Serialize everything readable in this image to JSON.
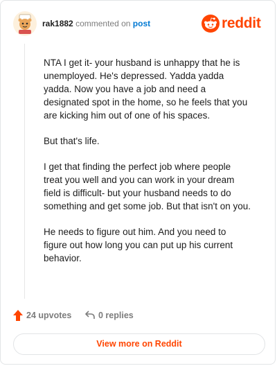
{
  "header": {
    "username": "rak1882",
    "action_text": "commented on",
    "target_link": "post",
    "brand_name": "reddit"
  },
  "comment": {
    "paragraphs": [
      "NTA I get it- your husband is unhappy that he is unemployed. He's depressed. Yadda yadda yadda. Now you have a job and need a designated spot in the home, so he feels that you are kicking him out of one of his spaces.",
      "But that's life.",
      "I get that finding the perfect job where people treat you well and you can work in your dream field is difficult- but your husband needs to do something and get some job. But that isn't on you.",
      "He needs to figure out him. And you need to figure out how long you can put up his current behavior."
    ]
  },
  "actions": {
    "upvotes_label": "24 upvotes",
    "replies_label": "0 replies"
  },
  "footer": {
    "view_more_label": "View more on Reddit"
  },
  "colors": {
    "brand": "#ff4500",
    "link": "#0079d3",
    "muted": "#7c7c7c"
  },
  "icons": {
    "upvote": "upvote-arrow-icon",
    "reply": "reply-arrow-icon",
    "brand": "reddit-logo-icon",
    "avatar": "user-avatar"
  }
}
